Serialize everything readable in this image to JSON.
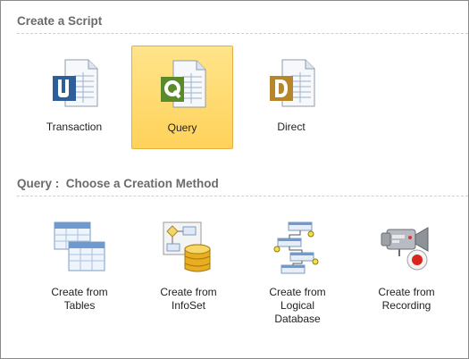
{
  "script_section": {
    "title": "Create a Script",
    "items": [
      {
        "label": "Transaction",
        "icon": "transaction-doc-icon",
        "selected": false
      },
      {
        "label": "Query",
        "icon": "query-doc-icon",
        "selected": true
      },
      {
        "label": "Direct",
        "icon": "direct-doc-icon",
        "selected": false
      }
    ]
  },
  "method_section": {
    "title": "Query :  Choose a Creation Method",
    "items": [
      {
        "lines": [
          "Create from",
          "Tables"
        ],
        "icon": "tables-icon"
      },
      {
        "lines": [
          "Create from",
          "InfoSet"
        ],
        "icon": "infoset-icon"
      },
      {
        "lines": [
          "Create from",
          "Logical",
          "Database"
        ],
        "icon": "logical-database-icon"
      },
      {
        "lines": [
          "Create from",
          "Recording"
        ],
        "icon": "recording-camera-icon"
      }
    ]
  },
  "colors": {
    "selection": "#ffd25a",
    "transaction": "#2e5f9a",
    "query": "#5a8a2a",
    "direct": "#b8862a"
  }
}
